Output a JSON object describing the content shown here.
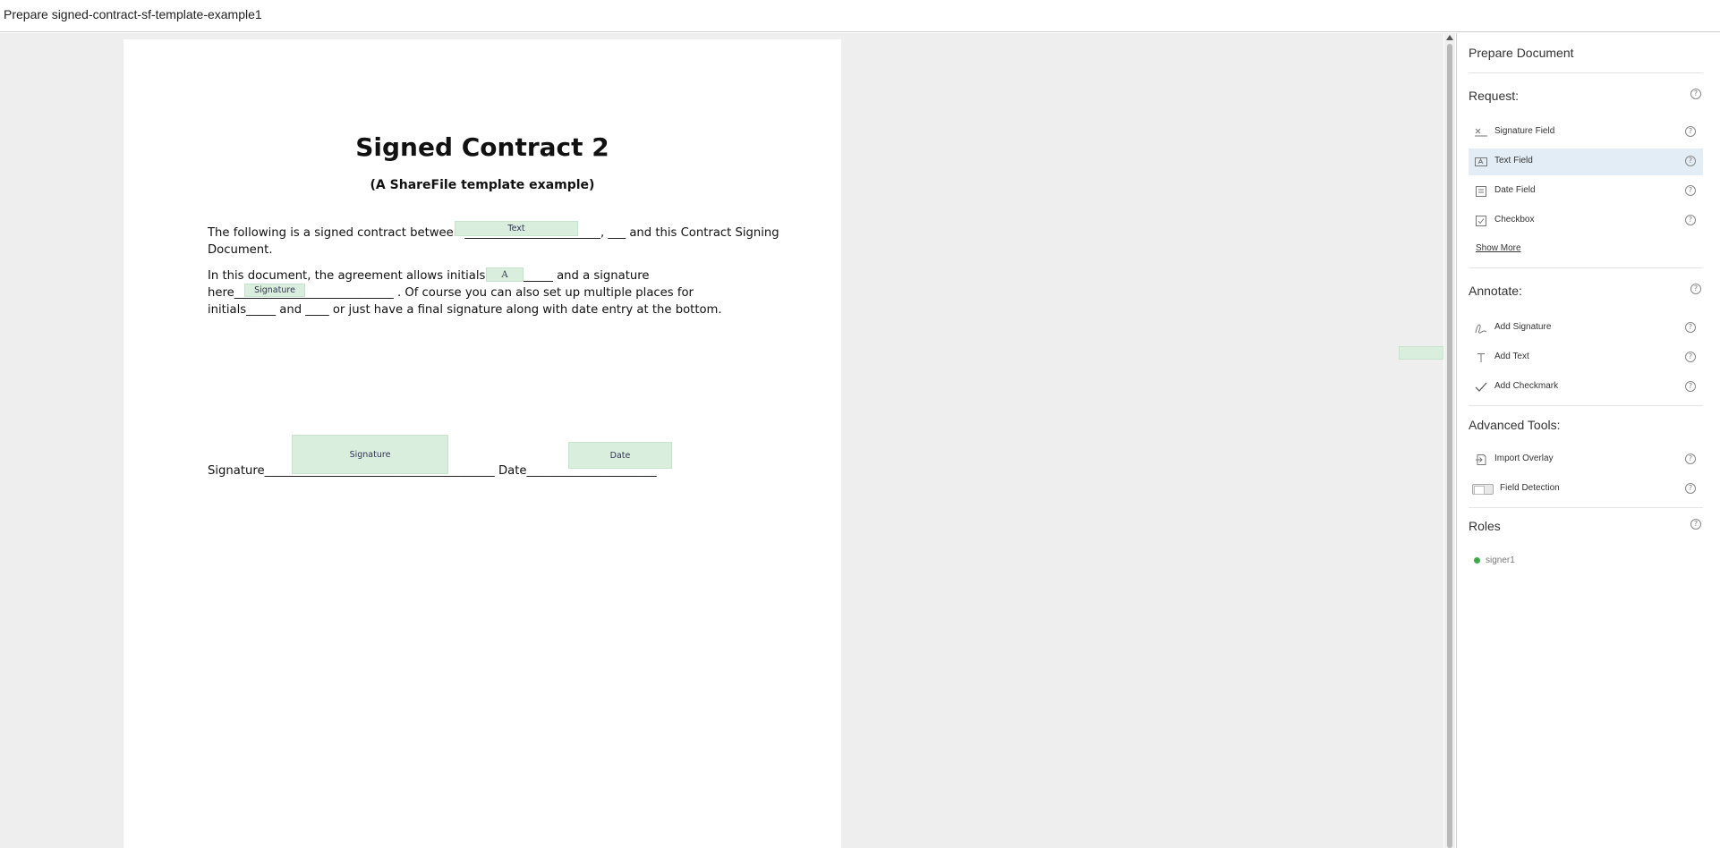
{
  "window": {
    "title": "Prepare signed-contract-sf-template-example1"
  },
  "document": {
    "title": "Signed Contract 2",
    "subtitle": "(A ShareFile template example)",
    "paragraph1": "The following is a signed contract between _______________________, ___ and this Contract Signing\nDocument.",
    "paragraph2": "In this document, the agreement allows initials here: _____ and a signature\nhere___________________________ . Of course you can also set up multiple places for\ninitials_____ and ____ or just have a final signature along with date entry at the bottom.",
    "signature_line": "Signature_______________________________________ Date______________________",
    "fields": {
      "text": "Text",
      "initials": "A",
      "signature_inline": "Signature",
      "signature_bottom": "Signature",
      "date": "Date"
    }
  },
  "panel": {
    "title": "Prepare Document",
    "request": {
      "heading": "Request:",
      "items": [
        {
          "label": "Signature Field",
          "icon": "signature-field-icon"
        },
        {
          "label": "Text Field",
          "icon": "text-field-icon",
          "selected": true
        },
        {
          "label": "Date Field",
          "icon": "date-field-icon"
        },
        {
          "label": "Checkbox",
          "icon": "checkbox-icon"
        }
      ],
      "show_more": "Show More"
    },
    "annotate": {
      "heading": "Annotate:",
      "items": [
        {
          "label": "Add Signature",
          "icon": "pen-icon"
        },
        {
          "label": "Add Text",
          "icon": "text-t-icon"
        },
        {
          "label": "Add Checkmark",
          "icon": "checkmark-icon"
        }
      ]
    },
    "advanced": {
      "heading": "Advanced Tools:",
      "items": [
        {
          "label": "Import Overlay",
          "icon": "import-icon"
        },
        {
          "label": "Field Detection",
          "icon": "toggle-icon"
        }
      ]
    },
    "roles": {
      "heading": "Roles",
      "items": [
        {
          "label": "signer1",
          "color": "#3daa4b"
        }
      ]
    }
  },
  "colors": {
    "field_fill": "#d9eedd",
    "selected_item": "#e3edf6",
    "viewer_bg": "#eeeeee"
  }
}
